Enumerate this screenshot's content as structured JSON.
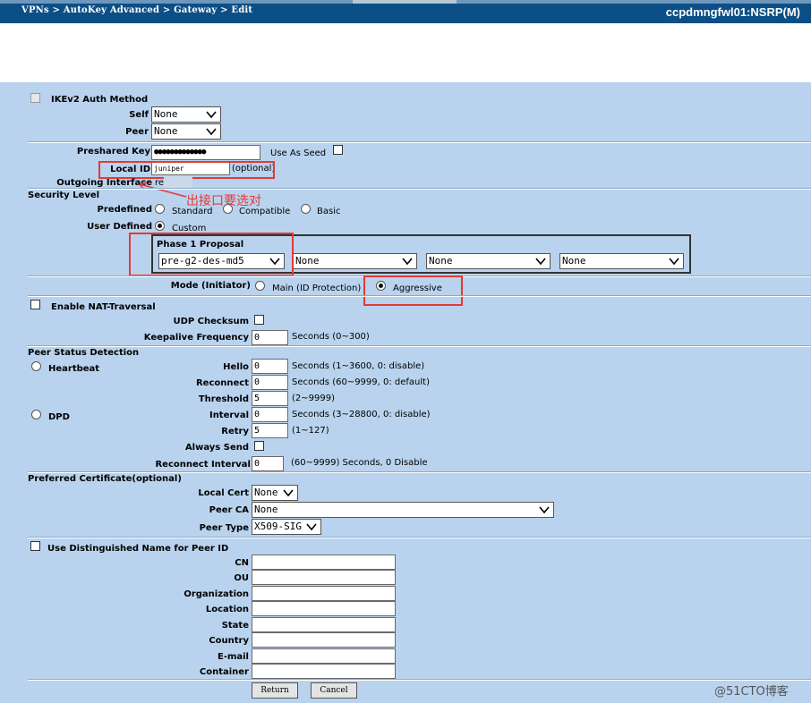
{
  "header": {
    "breadcrumb": "VPNs > AutoKey Advanced > Gateway > Edit",
    "device": "ccpdmngfwl01:NSRP(M)"
  },
  "ike": {
    "ikev2_label": "IKEv2 Auth Method",
    "self_label": "Self",
    "self_value": "None",
    "peer_label": "Peer",
    "peer_value": "None"
  },
  "auth": {
    "preshared_label": "Preshared Key",
    "preshared_value": "●●●●●●●●●●●●●",
    "use_as_seed": "Use As Seed",
    "local_id_label": "Local ID",
    "local_id_value": "juniper",
    "optional_text": "(optional)",
    "outgoing_label": "Outgoing Interface",
    "outgoing_value": "re",
    "annotation": "出接口要选对"
  },
  "security": {
    "section_label": "Security Level",
    "predefined_label": "Predefined",
    "standard": "Standard",
    "compatible": "Compatible",
    "basic": "Basic",
    "user_defined_label": "User Defined",
    "custom": "Custom",
    "phase1_title": "Phase 1 Proposal",
    "proposals": [
      "pre-g2-des-md5",
      "None",
      "None",
      "None"
    ]
  },
  "mode": {
    "label": "Mode (Initiator)",
    "main": "Main (ID Protection)",
    "aggressive": "Aggressive"
  },
  "nat": {
    "enable_label": "Enable NAT-Traversal",
    "udp_label": "UDP Checksum",
    "keepalive_label": "Keepalive Frequency",
    "keepalive_value": "0",
    "keepalive_hint": "Seconds (0~300)"
  },
  "psd": {
    "section_label": "Peer Status Detection",
    "heartbeat": "Heartbeat",
    "dpd": "DPD",
    "hello_label": "Hello",
    "hello_value": "0",
    "hello_hint": "Seconds (1~3600, 0: disable)",
    "reconnect_label": "Reconnect",
    "reconnect_value": "0",
    "reconnect_hint": "Seconds (60~9999, 0: default)",
    "threshold_label": "Threshold",
    "threshold_value": "5",
    "threshold_hint": "(2~9999)",
    "interval_label": "Interval",
    "interval_value": "0",
    "interval_hint": "Seconds (3~28800, 0: disable)",
    "retry_label": "Retry",
    "retry_value": "5",
    "retry_hint": "(1~127)",
    "always_send_label": "Always Send",
    "reconnect_interval_label": "Reconnect Interval",
    "reconnect_interval_value": "0",
    "reconnect_interval_hint": "(60~9999) Seconds, 0 Disable"
  },
  "cert": {
    "section_label": "Preferred Certificate(optional)",
    "local_cert_label": "Local Cert",
    "local_cert_value": "None",
    "peer_ca_label": "Peer CA",
    "peer_ca_value": "None",
    "peer_type_label": "Peer Type",
    "peer_type_value": "X509-SIG"
  },
  "dn": {
    "use_label": "Use Distinguished Name for Peer ID",
    "fields": [
      "CN",
      "OU",
      "Organization",
      "Location",
      "State",
      "Country",
      "E-mail",
      "Container"
    ]
  },
  "buttons": {
    "return": "Return",
    "cancel": "Cancel"
  },
  "watermark": "@51CTO博客"
}
